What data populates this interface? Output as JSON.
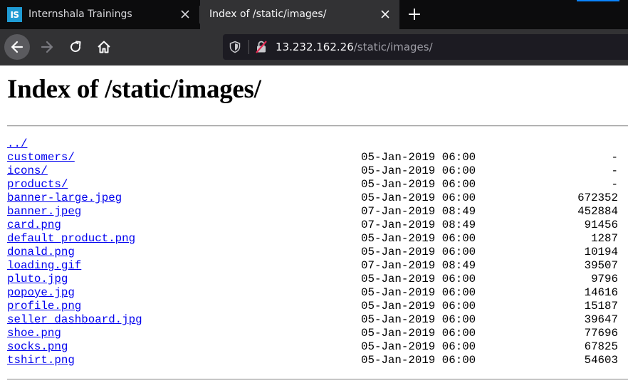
{
  "browser": {
    "tabs": [
      {
        "title": "Internshala Trainings",
        "favicon_text": "IS",
        "active": false
      },
      {
        "title": "Index of /static/images/",
        "active": true
      }
    ],
    "url_host": "13.232.162.26",
    "url_path": "/static/images/",
    "colors": {
      "chrome_dark": "#0c0c0d",
      "toolbar": "#323234",
      "urlbar": "#1c1b22",
      "favicon": "#1f9bd4",
      "accent": "#0a84ff"
    },
    "icons": [
      "back-arrow-icon",
      "forward-arrow-icon",
      "reload-icon",
      "home-icon",
      "tracking-shield-icon",
      "insecure-lock-icon",
      "close-icon",
      "plus-icon"
    ]
  },
  "page": {
    "heading": "Index of /static/images/",
    "parent_link": "../",
    "link_color": "#0000ee",
    "entries": [
      {
        "name": "customers/",
        "date": "05-Jan-2019 06:00",
        "size": "-"
      },
      {
        "name": "icons/",
        "date": "05-Jan-2019 06:00",
        "size": "-"
      },
      {
        "name": "products/",
        "date": "05-Jan-2019 06:00",
        "size": "-"
      },
      {
        "name": "banner-large.jpeg",
        "date": "05-Jan-2019 06:00",
        "size": "672352"
      },
      {
        "name": "banner.jpeg",
        "date": "07-Jan-2019 08:49",
        "size": "452884"
      },
      {
        "name": "card.png",
        "date": "07-Jan-2019 08:49",
        "size": "91456"
      },
      {
        "name": "default_product.png",
        "date": "05-Jan-2019 06:00",
        "size": "1287"
      },
      {
        "name": "donald.png",
        "date": "05-Jan-2019 06:00",
        "size": "10194"
      },
      {
        "name": "loading.gif",
        "date": "07-Jan-2019 08:49",
        "size": "39507"
      },
      {
        "name": "pluto.jpg",
        "date": "05-Jan-2019 06:00",
        "size": "9796"
      },
      {
        "name": "popoye.jpg",
        "date": "05-Jan-2019 06:00",
        "size": "14616"
      },
      {
        "name": "profile.png",
        "date": "05-Jan-2019 06:00",
        "size": "15187"
      },
      {
        "name": "seller_dashboard.jpg",
        "date": "05-Jan-2019 06:00",
        "size": "39647"
      },
      {
        "name": "shoe.png",
        "date": "05-Jan-2019 06:00",
        "size": "77696"
      },
      {
        "name": "socks.png",
        "date": "05-Jan-2019 06:00",
        "size": "67825"
      },
      {
        "name": "tshirt.png",
        "date": "05-Jan-2019 06:00",
        "size": "54603"
      }
    ]
  }
}
